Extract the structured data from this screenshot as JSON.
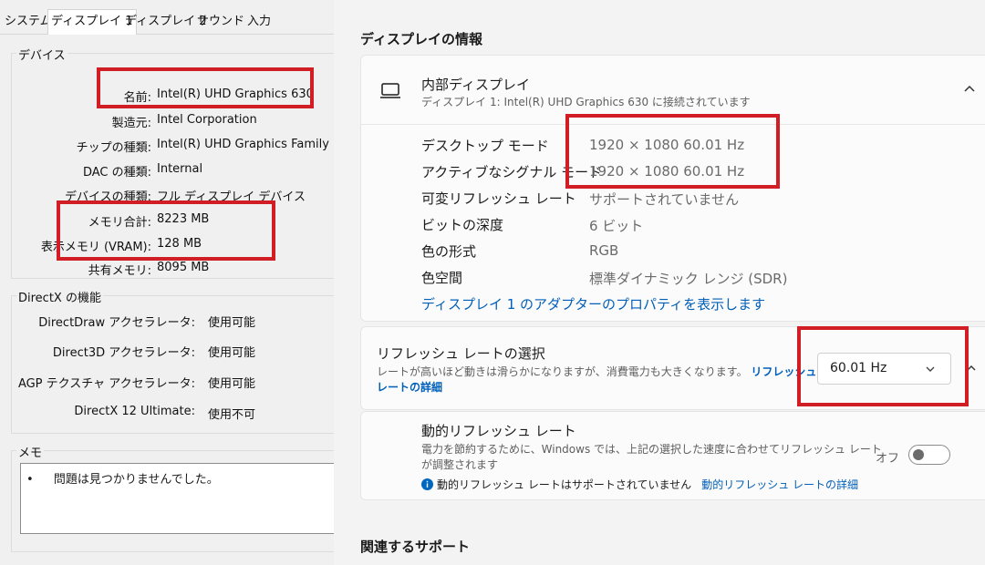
{
  "dxdiag": {
    "tabs": [
      "システム",
      "ディスプレイ 1",
      "ディスプレイ 2",
      "サウンド",
      "入力"
    ],
    "device_group_title": "デバイス",
    "device_rows": [
      {
        "label": "名前:",
        "value": "Intel(R) UHD Graphics 630"
      },
      {
        "label": "製造元:",
        "value": "Intel Corporation"
      },
      {
        "label": "チップの種類:",
        "value": "Intel(R) UHD Graphics Family"
      },
      {
        "label": "DAC の種類:",
        "value": "Internal"
      },
      {
        "label": "デバイスの種類:",
        "value": "フル ディスプレイ デバイス"
      },
      {
        "label": "メモリ合計:",
        "value": "8223 MB"
      },
      {
        "label": "表示メモリ (VRAM):",
        "value": "128 MB"
      },
      {
        "label": "共有メモリ:",
        "value": "8095 MB"
      }
    ],
    "directx_group_title": "DirectX の機能",
    "directx_rows": [
      {
        "label": "DirectDraw アクセラレータ:",
        "value": "使用可能"
      },
      {
        "label": "Direct3D アクセラレータ:",
        "value": "使用可能"
      },
      {
        "label": "AGP テクスチャ アクセラレータ:",
        "value": "使用可能"
      },
      {
        "label": "DirectX 12 Ultimate:",
        "value": "使用不可"
      }
    ],
    "memo_group_title": "メモ",
    "memo_bullet": "•",
    "memo_items": [
      "問題は見つかりませんでした。"
    ]
  },
  "settings": {
    "display_info_heading": "ディスプレイの情報",
    "monitor": {
      "title": "内部ディスプレイ",
      "subtitle": "ディスプレイ 1: Intel(R) UHD Graphics 630 に接続されています",
      "rows": [
        {
          "label": "デスクトップ モード",
          "value": "1920 × 1080 60.01 Hz"
        },
        {
          "label": "アクティブなシグナル モード",
          "value": "1920 × 1080 60.01 Hz"
        },
        {
          "label": "可変リフレッシュ レート",
          "value": "サポートされていません"
        },
        {
          "label": "ビットの深度",
          "value": "6 ビット"
        },
        {
          "label": "色の形式",
          "value": "RGB"
        },
        {
          "label": "色空間",
          "value": "標準ダイナミック レンジ (SDR)"
        }
      ],
      "adapter_link": "ディスプレイ 1 のアダプターのプロパティを表示します"
    },
    "refresh": {
      "title": "リフレッシュ レートの選択",
      "desc_line1": "レートが高いほど動きは滑らかになりますが、消費電力も大きくなります。",
      "desc_link_part1": "リフレッシュ",
      "desc_link_part2": "レートの詳細",
      "selected_rate": "60.01 Hz"
    },
    "dynamic_refresh": {
      "title": "動的リフレッシュ レート",
      "desc_line1": "電力を節約するために、Windows では、上記の選択した速度に合わせてリフレッシュ レート",
      "desc_line2": "が調整されます",
      "toggle_label": "オフ",
      "toggle_on": false,
      "info_icon": "info-icon",
      "notice": "動的リフレッシュ レートはサポートされていません",
      "notice_link": "動的リフレッシュ レートの詳細"
    },
    "related_heading": "関連するサポート"
  },
  "colors": {
    "highlight_red": "#d11d24",
    "link_blue": "#005fb8",
    "info_blue": "#0067c0"
  }
}
